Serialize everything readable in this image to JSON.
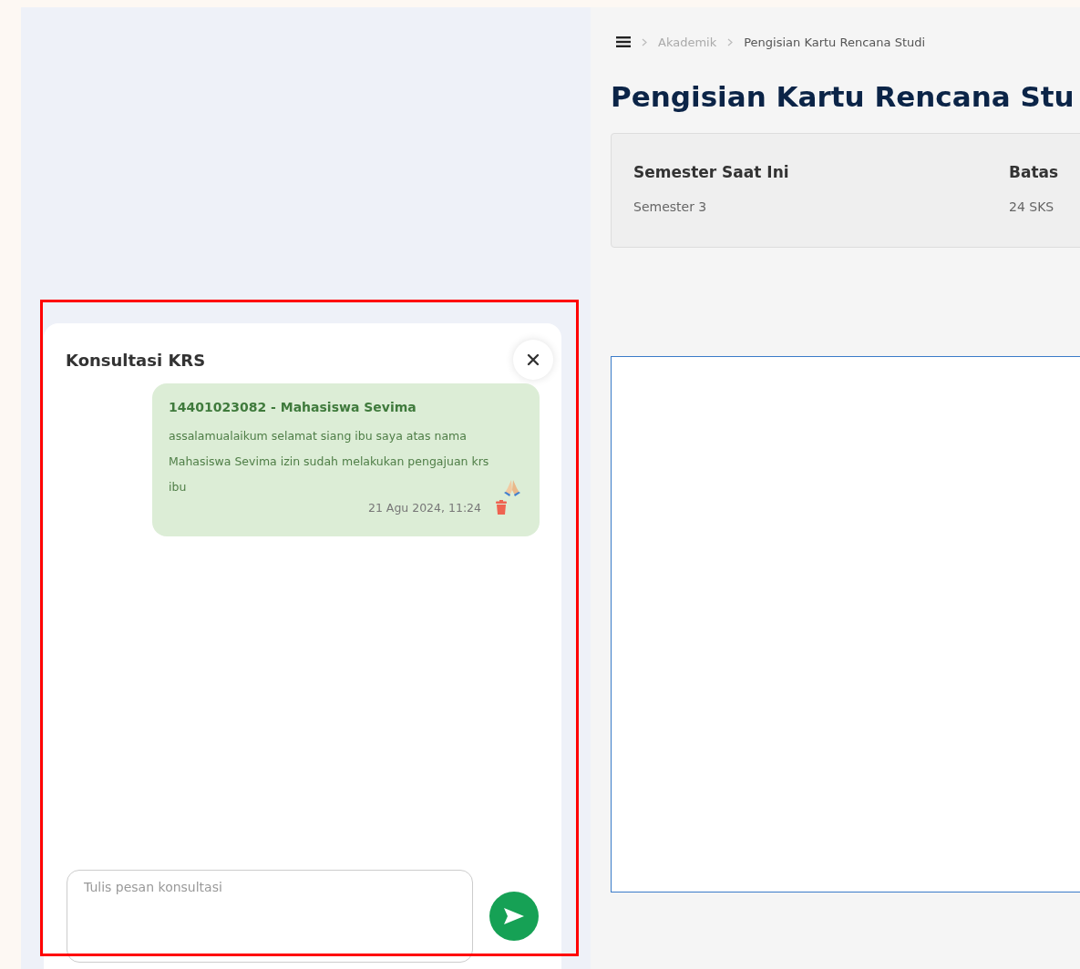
{
  "chat": {
    "title": "Konsultasi KRS",
    "messages": [
      {
        "sender": "14401023082 - Mahasiswa Sevima",
        "text": "assalamualaikum selamat siang ibu saya atas nama Mahasiswa Sevima izin sudah melakukan pengajuan krs ibu",
        "time": "21 Agu 2024, 11:24"
      }
    ],
    "input": {
      "placeholder": "Tulis pesan konsultasi"
    }
  },
  "breadcrumb": [
    {
      "label": "Akademik",
      "current": false
    },
    {
      "label": "Pengisian Kartu Rencana Studi",
      "current": true
    }
  ],
  "page_title": "Pengisian Kartu Rencana Stu",
  "info": [
    {
      "label": "Semester Saat Ini",
      "value": "Semester 3"
    },
    {
      "label": "Batas",
      "value": "24 SKS"
    }
  ]
}
